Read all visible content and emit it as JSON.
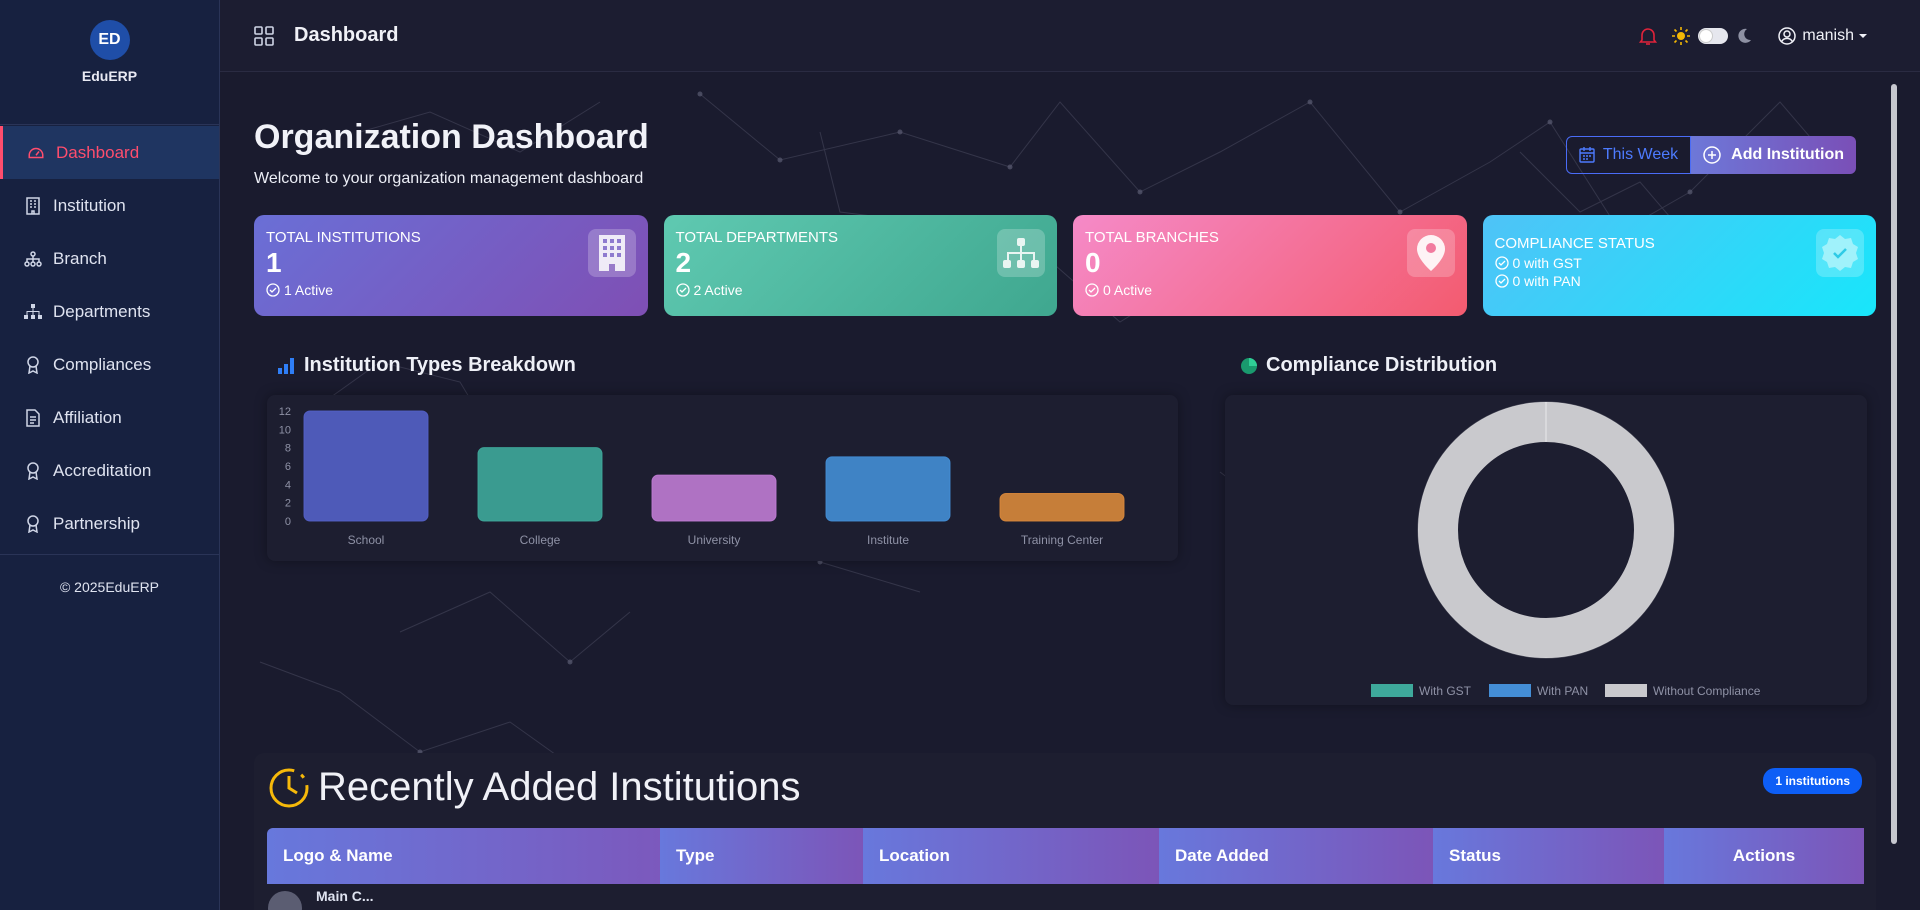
{
  "app": {
    "logo_initials": "ED",
    "logo_name": "EduERP"
  },
  "sidebar": {
    "items": [
      {
        "label": "Dashboard",
        "icon": "dashboard-icon",
        "active": true
      },
      {
        "label": "Institution",
        "icon": "building-icon"
      },
      {
        "label": "Branch",
        "icon": "sitemap-icon"
      },
      {
        "label": "Departments",
        "icon": "hierarchy-icon"
      },
      {
        "label": "Compliances",
        "icon": "award-icon"
      },
      {
        "label": "Affiliation",
        "icon": "document-icon"
      },
      {
        "label": "Accreditation",
        "icon": "award-icon"
      },
      {
        "label": "Partnership",
        "icon": "award-icon"
      }
    ],
    "copyright": "© 2025EduERP"
  },
  "topbar": {
    "title": "Dashboard",
    "username": "manish"
  },
  "header": {
    "title": "Organization Dashboard",
    "subtitle": "Welcome to your organization management dashboard",
    "this_week": "This Week",
    "add_institution": "Add Institution"
  },
  "cards": [
    {
      "label": "TOTAL INSTITUTIONS",
      "value": "1",
      "sub": "1 Active",
      "icon": "building-icon",
      "color": "#7163d0"
    },
    {
      "label": "TOTAL DEPARTMENTS",
      "value": "2",
      "sub": "2 Active",
      "icon": "sitemap-icon",
      "color": "#4fb9a0"
    },
    {
      "label": "TOTAL BRANCHES",
      "value": "0",
      "sub": "0 Active",
      "icon": "map-pin-icon",
      "color": "#f4709a"
    },
    {
      "label": "COMPLIANCE STATUS",
      "sub1": "0 with GST",
      "sub2": "0 with PAN",
      "icon": "badge-check-icon",
      "color": "#2fd4f8"
    }
  ],
  "sections": {
    "types_title": "Institution Types Breakdown",
    "compliance_title": "Compliance Distribution"
  },
  "chart_data": [
    {
      "type": "bar",
      "categories": [
        "School",
        "College",
        "University",
        "Institute",
        "Training Center"
      ],
      "values": [
        12,
        8,
        5,
        7,
        3
      ],
      "colors": [
        "#5461c8",
        "#3ea99b",
        "#c07bd4",
        "#448ed6",
        "#d9883b"
      ],
      "yticks": [
        0,
        2,
        4,
        6,
        8,
        10,
        12
      ],
      "ylim": [
        0,
        12
      ]
    },
    {
      "type": "pie",
      "labels": [
        "With GST",
        "With PAN",
        "Without Compliance"
      ],
      "values": [
        0,
        0,
        1
      ],
      "colors": [
        "#3ea99b",
        "#448ed6",
        "#c9c9cd"
      ],
      "legend": "bottom"
    }
  ],
  "recent": {
    "title": "Recently Added Institutions",
    "badge": "1 institutions",
    "columns": [
      "Logo & Name",
      "Type",
      "Location",
      "Date Added",
      "Status",
      "Actions"
    ],
    "first_row_name": "Main C..."
  }
}
